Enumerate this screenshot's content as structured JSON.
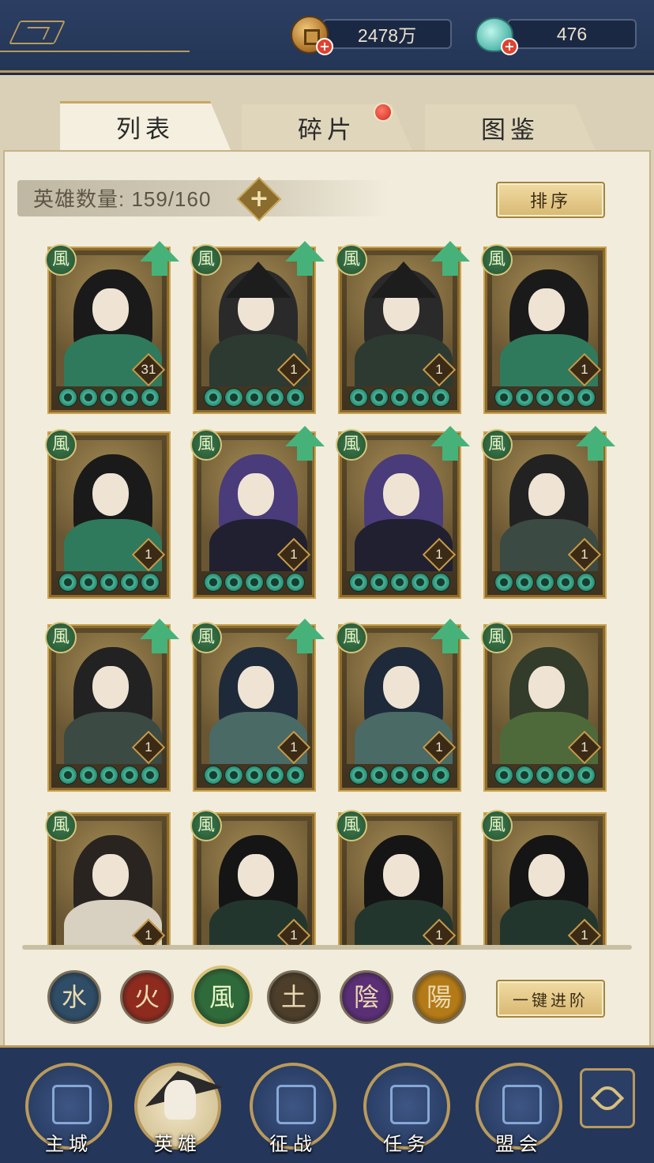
{
  "currencies": {
    "coins": "2478万",
    "gems": "476"
  },
  "tabs": [
    {
      "label": "列表",
      "active": true
    },
    {
      "label": "碎片",
      "active": false,
      "has_notification": true
    },
    {
      "label": "图鉴",
      "active": false
    }
  ],
  "hero_count_label": "英雄数量: 159/160",
  "sort_button": "排序",
  "one_click_upgrade": "一键进阶",
  "heroes": [
    {
      "element": "風",
      "level": "31",
      "upgradable": true
    },
    {
      "element": "風",
      "level": "1",
      "upgradable": true
    },
    {
      "element": "風",
      "level": "1",
      "upgradable": true
    },
    {
      "element": "風",
      "level": "1",
      "upgradable": false
    },
    {
      "element": "風",
      "level": "1",
      "upgradable": false
    },
    {
      "element": "風",
      "level": "1",
      "upgradable": true
    },
    {
      "element": "風",
      "level": "1",
      "upgradable": true
    },
    {
      "element": "風",
      "level": "1",
      "upgradable": true
    },
    {
      "element": "風",
      "level": "1",
      "upgradable": true
    },
    {
      "element": "風",
      "level": "1",
      "upgradable": true
    },
    {
      "element": "風",
      "level": "1",
      "upgradable": true
    },
    {
      "element": "風",
      "level": "1",
      "upgradable": false
    },
    {
      "element": "風",
      "level": "1",
      "upgradable": false
    },
    {
      "element": "風",
      "level": "1",
      "upgradable": false
    },
    {
      "element": "風",
      "level": "1",
      "upgradable": false
    },
    {
      "element": "風",
      "level": "1",
      "upgradable": false
    }
  ],
  "element_filters": [
    {
      "glyph": "水",
      "color": "#2f4d66",
      "selected": false
    },
    {
      "glyph": "火",
      "color": "#8e2b1e",
      "selected": false
    },
    {
      "glyph": "風",
      "color": "#2f6a3a",
      "selected": true
    },
    {
      "glyph": "土",
      "color": "#4d3e2a",
      "selected": false
    },
    {
      "glyph": "陰",
      "color": "#5a2f76",
      "selected": false
    },
    {
      "glyph": "陽",
      "color": "#b37a17",
      "selected": false
    }
  ],
  "bottom_nav": [
    {
      "label": "主城",
      "active": false
    },
    {
      "label": "英雄",
      "active": true
    },
    {
      "label": "征战",
      "active": false
    },
    {
      "label": "任务",
      "active": false
    },
    {
      "label": "盟会",
      "active": false
    }
  ]
}
